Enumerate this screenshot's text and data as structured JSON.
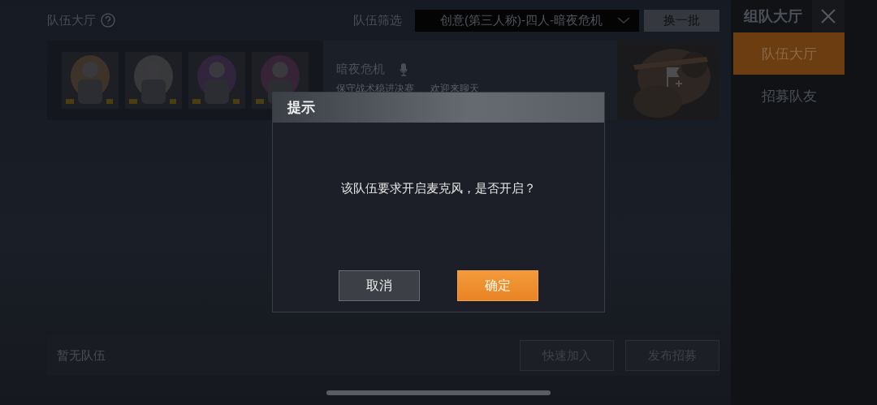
{
  "header": {
    "title": "队伍大厅",
    "filter_label": "队伍筛选",
    "filter_value": "创意(第三人称)-四人-暗夜危机",
    "refresh_button": "换一批"
  },
  "sidebar": {
    "title": "组队大厅",
    "tabs": [
      {
        "label": "队伍大厅",
        "selected": true
      },
      {
        "label": "招募队友",
        "selected": false
      }
    ]
  },
  "team_card": {
    "name": "暗夜危机",
    "notes": [
      "保守战术稳进决赛",
      "欢迎来聊天"
    ]
  },
  "bottom_bar": {
    "empty_text": "暂无队伍",
    "buttons": [
      "快速加入",
      "发布招募"
    ]
  },
  "dialog": {
    "title": "提示",
    "message": "该队伍要求开启麦克风，是否开启？",
    "buttons": [
      {
        "label": "取消",
        "kind": "secondary"
      },
      {
        "label": "确定",
        "kind": "primary"
      }
    ]
  }
}
